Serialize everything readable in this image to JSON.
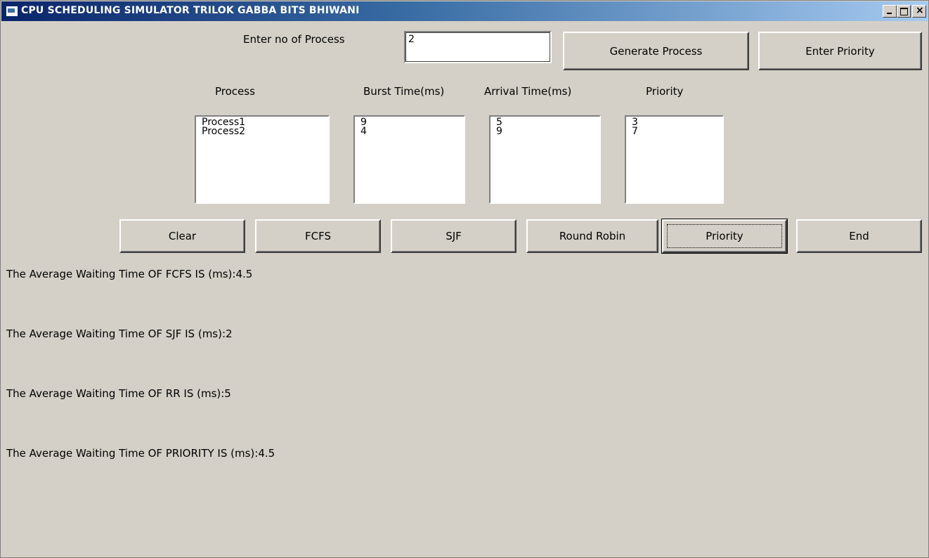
{
  "window": {
    "title": "CPU SCHEDULING SIMULATOR TRILOK GABBA BITS BHIWANI"
  },
  "form": {
    "num_process_label": "Enter no of Process",
    "num_process_value": "2",
    "generate_button": "Generate Process",
    "enter_priority_button": "Enter Priority"
  },
  "columns": {
    "process": "Process",
    "burst": "Burst Time(ms)",
    "arrival": "Arrival Time(ms)",
    "priority": "Priority"
  },
  "lists": {
    "process": [
      "Process1",
      "Process2"
    ],
    "burst": [
      "9",
      "4"
    ],
    "arrival": [
      "5",
      "9"
    ],
    "priority": [
      "3",
      "7"
    ]
  },
  "buttons": {
    "clear": "Clear",
    "fcfs": "FCFS",
    "sjf": "SJF",
    "rr": "Round Robin",
    "priority": "Priority",
    "end": "End"
  },
  "results": {
    "fcfs": "The Average Waiting Time OF FCFS IS (ms):4.5",
    "sjf": "The Average Waiting Time OF SJF IS (ms):2",
    "rr": "The Average Waiting Time OF RR IS (ms):5",
    "priority": "The Average Waiting Time OF PRIORITY IS (ms):4.5"
  },
  "colors": {
    "window_bg": "#d4d0c8",
    "titlebar_start": "#0a246a",
    "titlebar_end": "#a6caf0"
  }
}
